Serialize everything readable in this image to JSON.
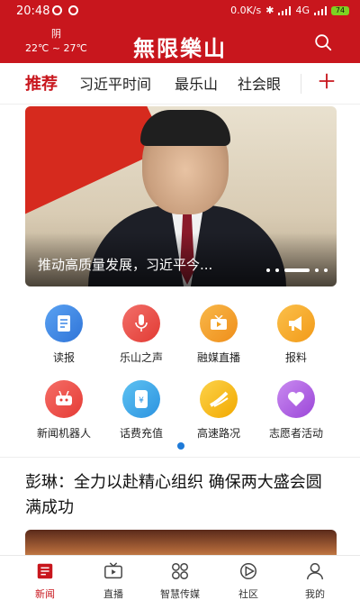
{
  "status": {
    "time": "20:48",
    "network": "0.0K/s",
    "carrier": "4G",
    "battery": "74"
  },
  "header": {
    "weather_condition": "阴",
    "temperature": "22℃ ~ 27℃",
    "logo_text": "無限樂山"
  },
  "tabs": [
    {
      "label": "推荐",
      "active": true
    },
    {
      "label": "习近平时间"
    },
    {
      "label": "最乐山"
    },
    {
      "label": "社会眼"
    }
  ],
  "banner": {
    "caption": "推动高质量发展，习近平今..."
  },
  "services": [
    {
      "label": "读报",
      "icon": "newspaper-icon",
      "color": "#3b86e6"
    },
    {
      "label": "乐山之声",
      "icon": "microphone-icon",
      "color": "#e8453c"
    },
    {
      "label": "融媒直播",
      "icon": "tv-icon",
      "color": "#f0a020"
    },
    {
      "label": "报料",
      "icon": "megaphone-icon",
      "color": "#f6a623"
    },
    {
      "label": "新闻机器人",
      "icon": "robot-icon",
      "color": "#ef4f4a"
    },
    {
      "label": "话费充值",
      "icon": "phone-recharge-icon",
      "color": "#3aa7e8"
    },
    {
      "label": "高速路况",
      "icon": "road-icon",
      "color": "#f4b400"
    },
    {
      "label": "志愿者活动",
      "icon": "heart-icon",
      "color": "#b05ee0"
    }
  ],
  "article": {
    "headline": "彭琳：全力以赴精心组织 确保两大盛会圆满成功"
  },
  "bottom_nav": [
    {
      "label": "新闻",
      "icon": "news-icon",
      "active": true
    },
    {
      "label": "直播",
      "icon": "live-tv-icon"
    },
    {
      "label": "智慧传媒",
      "icon": "apps-icon"
    },
    {
      "label": "社区",
      "icon": "community-icon"
    },
    {
      "label": "我的",
      "icon": "profile-icon"
    }
  ],
  "colors": {
    "brand_red": "#c8161d",
    "indicator_blue": "#1e7ad8"
  }
}
